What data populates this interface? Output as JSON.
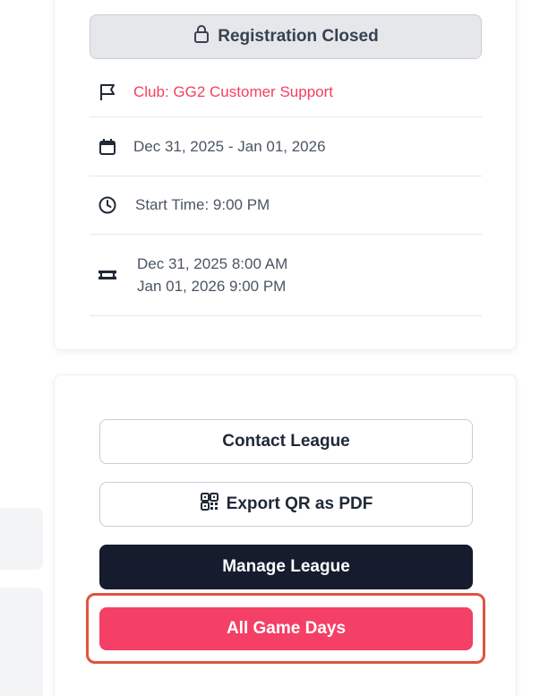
{
  "registration": {
    "label": "Registration Closed",
    "icon": "lock-icon"
  },
  "details": {
    "club": {
      "icon": "flag-icon",
      "text": "Club: GG2 Customer Support",
      "color": "#f43f5e"
    },
    "dates": {
      "icon": "calendar-icon",
      "text": "Dec 31, 2025 - Jan 01, 2026"
    },
    "start_time": {
      "icon": "clock-icon",
      "text": "Start Time: 9:00 PM"
    },
    "registration_window": {
      "icon": "ticket-icon",
      "open": "Dec 31, 2025 8:00 AM",
      "close": "Jan 01, 2026 9:00 PM"
    }
  },
  "actions": {
    "contact_label": "Contact League",
    "export_label": "Export QR as PDF",
    "export_icon": "qr-code-icon",
    "manage_label": "Manage League",
    "game_days_label": "All Game Days"
  },
  "colors": {
    "accent": "#f43f66",
    "dark_button": "#161b2e",
    "highlight": "#e0533f"
  }
}
